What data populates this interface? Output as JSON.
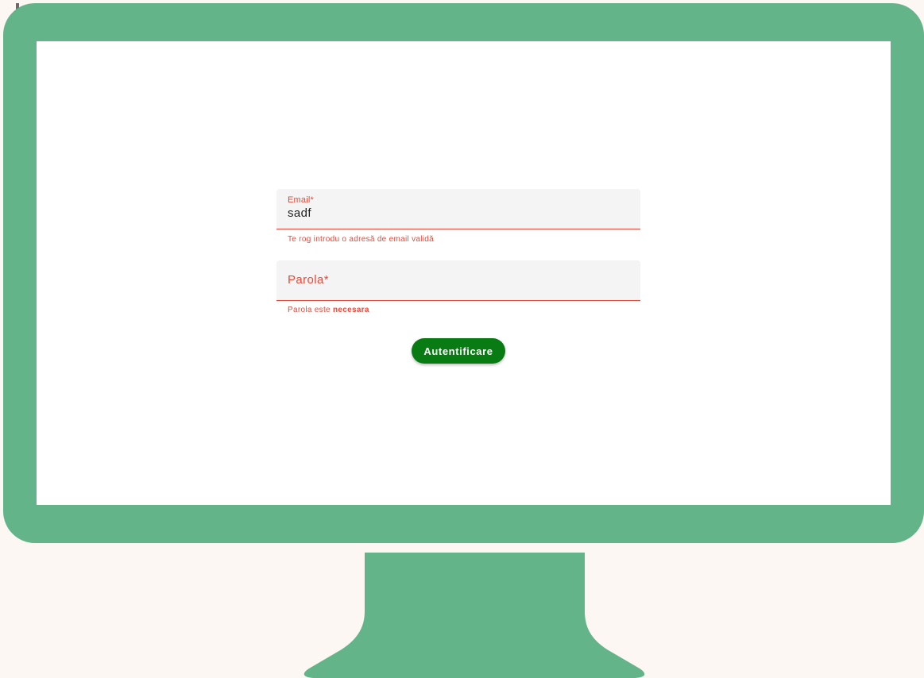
{
  "colors": {
    "background": "#fcf7f3",
    "monitor": "#63b489",
    "screen": "#ffffff",
    "field_background": "#f4f4f4",
    "error": "#e64a3b",
    "button": "#087c12",
    "button_text": "#ffffff"
  },
  "login_form": {
    "email": {
      "label": "Email*",
      "value": "sadf",
      "error": "Te rog introdu o adresă de email validă"
    },
    "password": {
      "label": "Parola*",
      "value": "",
      "error_prefix": "Parola este ",
      "error_emphasis": "necesara"
    },
    "submit_label": "Autentificare"
  }
}
